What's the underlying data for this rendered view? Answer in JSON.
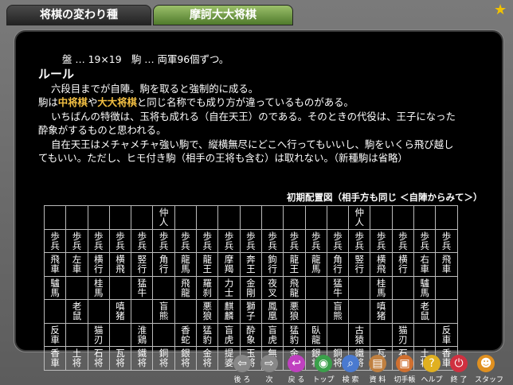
{
  "tabs": {
    "tab1": "将棋の変わり種",
    "tab2": "摩訶大大将棋"
  },
  "text": {
    "board_info": "盤 … 19×19　駒 … 両軍96個ずつ。",
    "rule_heading": "ルール",
    "p1": "六段目までが自陣。駒を取ると強制的に成る。",
    "p2_a": "駒は",
    "p2_b": "中将棋",
    "p2_c": "や",
    "p2_d": "大大将棋",
    "p2_e": "と同じ名称でも成り方が違っているものがある。",
    "p3_1": "いちばんの特徴は、玉将も成れる（自在天王）のである。そのときの代役は、王子になった",
    "p3_2": "酔象がするものと思われる。",
    "p4_1": "自在天王はメチャメチャ強い駒で、縦横無尽にどこへ行ってもいいし、駒をいくら飛び越し",
    "p4_2": "てもいい。ただし、ヒモ付き駒（相手の王将も含む）は取れない。（新種駒は省略）",
    "caption": "初期配置図（相手方も同じ ＜自陣からみて＞）"
  },
  "board": [
    [
      "",
      "",
      "",
      "",
      "",
      "仲人",
      "",
      "",
      "",
      "",
      "",
      "",
      "",
      "",
      "仲人",
      "",
      "",
      "",
      ""
    ],
    [
      "歩兵",
      "歩兵",
      "歩兵",
      "歩兵",
      "歩兵",
      "歩兵",
      "歩兵",
      "歩兵",
      "歩兵",
      "歩兵",
      "歩兵",
      "歩兵",
      "歩兵",
      "歩兵",
      "歩兵",
      "歩兵",
      "歩兵",
      "歩兵",
      "歩兵"
    ],
    [
      "飛車",
      "左車",
      "横行",
      "横飛",
      "竪行",
      "角行",
      "龍馬",
      "龍王",
      "摩羯",
      "奔王",
      "鉤行",
      "龍王",
      "龍馬",
      "角行",
      "竪行",
      "横飛",
      "横行",
      "右車",
      "飛車"
    ],
    [
      "驢馬",
      "",
      "桂馬",
      "",
      "猛牛",
      "",
      "飛龍",
      "羅刹",
      "力士",
      "金剛",
      "夜叉",
      "飛龍",
      "",
      "猛牛",
      "",
      "桂馬",
      "",
      "驢馬",
      ""
    ],
    [
      "",
      "老鼠",
      "",
      "嗔猪",
      "",
      "盲熊",
      "",
      "悪狼",
      "麒麟",
      "獅子",
      "鳳凰",
      "悪狼",
      "",
      "盲熊",
      "",
      "嗔猪",
      "",
      "老鼠",
      ""
    ],
    [
      "反車",
      "",
      "猫刃",
      "",
      "淮鶏",
      "",
      "香蛇",
      "猛豹",
      "盲虎",
      "酔象",
      "盲虎",
      "猛豹",
      "臥龍",
      "",
      "古猿",
      "",
      "猫刃",
      "",
      "反車"
    ],
    [
      "香車",
      "土将",
      "石将",
      "瓦将",
      "鐵将",
      "銅将",
      "銀将",
      "金将",
      "提婆",
      "玉将",
      "無明",
      "金将",
      "銀将",
      "銅将",
      "鐵将",
      "瓦将",
      "石将",
      "土将",
      "香車"
    ]
  ],
  "toolbar": [
    {
      "name": "back",
      "label": "後 ろ",
      "icon": "back-arrow-icon",
      "color": "#888888"
    },
    {
      "name": "next",
      "label": "次",
      "icon": "forward-arrow-icon",
      "color": "#888888"
    },
    {
      "name": "return",
      "label": "戻 る",
      "icon": "return-icon",
      "color": "#c040c0"
    },
    {
      "name": "top",
      "label": "トップ",
      "icon": "globe-icon",
      "color": "#3aa04a"
    },
    {
      "name": "search",
      "label": "検 索",
      "icon": "magnifier-icon",
      "color": "#4a7ad0"
    },
    {
      "name": "data",
      "label": "資 料",
      "icon": "book-icon",
      "color": "#c08040"
    },
    {
      "name": "kiribuda",
      "label": "切手帳",
      "icon": "stamp-icon",
      "color": "#d07030"
    },
    {
      "name": "help",
      "label": "ヘルプ",
      "icon": "help-icon",
      "color": "#e0b020"
    },
    {
      "name": "exit",
      "label": "終 了",
      "icon": "power-icon",
      "color": "#d03040"
    },
    {
      "name": "staff",
      "label": "スタッフ",
      "icon": "staff-icon",
      "color": "#e09020"
    }
  ]
}
